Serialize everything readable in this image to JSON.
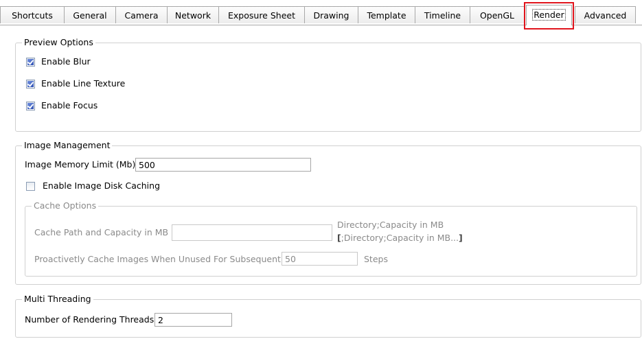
{
  "tabs": [
    {
      "label": "Shortcuts"
    },
    {
      "label": "General"
    },
    {
      "label": "Camera"
    },
    {
      "label": "Network"
    },
    {
      "label": "Exposure Sheet"
    },
    {
      "label": "Drawing"
    },
    {
      "label": "Template"
    },
    {
      "label": "Timeline"
    },
    {
      "label": "OpenGL"
    },
    {
      "label": "Render"
    },
    {
      "label": "Advanced"
    }
  ],
  "active_tab": "Render",
  "highlight_color": "#e0141c",
  "preview_options": {
    "title": "Preview Options",
    "enable_blur": {
      "label": "Enable Blur",
      "checked": true
    },
    "enable_line_texture": {
      "label": "Enable Line Texture",
      "checked": true
    },
    "enable_focus": {
      "label": "Enable Focus",
      "checked": true
    }
  },
  "image_management": {
    "title": "Image Management",
    "memory_limit_label": "Image Memory Limit (Mb):",
    "memory_limit_value": "500",
    "disk_caching": {
      "label": "Enable Image Disk Caching",
      "checked": false
    },
    "cache_options": {
      "title": "Cache Options",
      "path_label": "Cache Path and Capacity in MB",
      "path_value": "",
      "hint_line1": "Directory;Capacity in MB",
      "hint_line2_bracket_open": "[",
      "hint_line2_text": ";Directory;Capacity in MB...",
      "hint_line2_bracket_close": "]",
      "proactive_label": "Proactivetly Cache Images When Unused For Subsequent",
      "proactive_value": "50",
      "steps_label": "Steps"
    }
  },
  "multi_threading": {
    "title": "Multi Threading",
    "threads_label": "Number of Rendering Threads",
    "threads_value": "2"
  }
}
